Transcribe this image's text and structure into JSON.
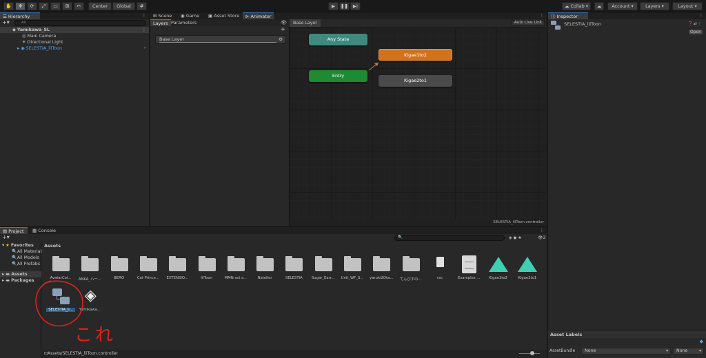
{
  "toolbar": {
    "pivot_label": "Center",
    "space_label": "Global",
    "play_icons": [
      "play-icon",
      "pause-icon",
      "step-icon"
    ],
    "collab_label": "Collab",
    "account_label": "Account",
    "layers_label": "Layers",
    "layout_label": "Layout"
  },
  "hierarchy": {
    "tab_label": "Hierarchy",
    "search_placeholder": "All",
    "scene_name": "Yamikawa_SL",
    "items": [
      "Main Camera",
      "Directional Light",
      "SELESTIA_lilToon"
    ]
  },
  "center_tabs": [
    "Scene",
    "Game",
    "Asset Store",
    "Animator"
  ],
  "animator": {
    "side_tabs": [
      "Layers",
      "Parameters"
    ],
    "layer_name": "Base Layer",
    "breadcrumb": "Base Layer",
    "auto_live_link": "Auto Live Link",
    "footer_file": "SELESTIA_lilToon.controller",
    "nodes": {
      "any_state": "Any State",
      "entry": "Entry",
      "state1": "Kigae1to2",
      "state2": "Kigae2to1"
    },
    "colors": {
      "any_state": "#3f8a7e",
      "entry": "#1f8a34",
      "default_state": "#d2731b",
      "state": "#4a4a4a"
    }
  },
  "inspector": {
    "tab_label": "Inspector",
    "object_name": "SELESTIA_lilToon",
    "open_button": "Open",
    "asset_labels_title": "Asset Labels",
    "asset_bundle_label": "AssetBundle",
    "asset_bundle_value": "None",
    "asset_variant_value": "None"
  },
  "project": {
    "tabs": [
      "Project",
      "Console"
    ],
    "favorites_label": "Favorites",
    "favorites": [
      "All Materials",
      "All Models",
      "All Prefabs"
    ],
    "roots": [
      "Assets",
      "Packages"
    ],
    "breadcrumb": "Assets",
    "hidden_count": "2",
    "row1": [
      {
        "name": "AvatarCol...",
        "kind": "folder"
      },
      {
        "name": "ANKA_ハー...",
        "kind": "folder"
      },
      {
        "name": "BERO",
        "kind": "folder"
      },
      {
        "name": "Cat Prince...",
        "kind": "folder"
      },
      {
        "name": "EXTENSIO...",
        "kind": "folder"
      },
      {
        "name": "lilToon",
        "kind": "folder"
      },
      {
        "name": "MMN set s...",
        "kind": "folder"
      },
      {
        "name": "Nateller",
        "kind": "folder"
      },
      {
        "name": "SELESTIA",
        "kind": "folder"
      },
      {
        "name": "Sugar_Earr...",
        "kind": "folder"
      },
      {
        "name": "Unit_WF_S...",
        "kind": "folder"
      },
      {
        "name": "yaruki20ka...",
        "kind": "folder"
      },
      {
        "name": "てんびすの...",
        "kind": "folder"
      },
      {
        "name": "csc",
        "kind": "file"
      },
      {
        "name": "Examples ...",
        "kind": "doc"
      },
      {
        "name": "Kigae1to2",
        "kind": "anim"
      },
      {
        "name": "Kigae2to1",
        "kind": "anim"
      }
    ],
    "row2": [
      {
        "name": "SELESTIA_li...",
        "kind": "controller"
      },
      {
        "name": "Yamikawa...",
        "kind": "unity"
      }
    ],
    "annotation_text": "これ",
    "status_path": "Assets/SELESTIA_lilToon.controller"
  }
}
